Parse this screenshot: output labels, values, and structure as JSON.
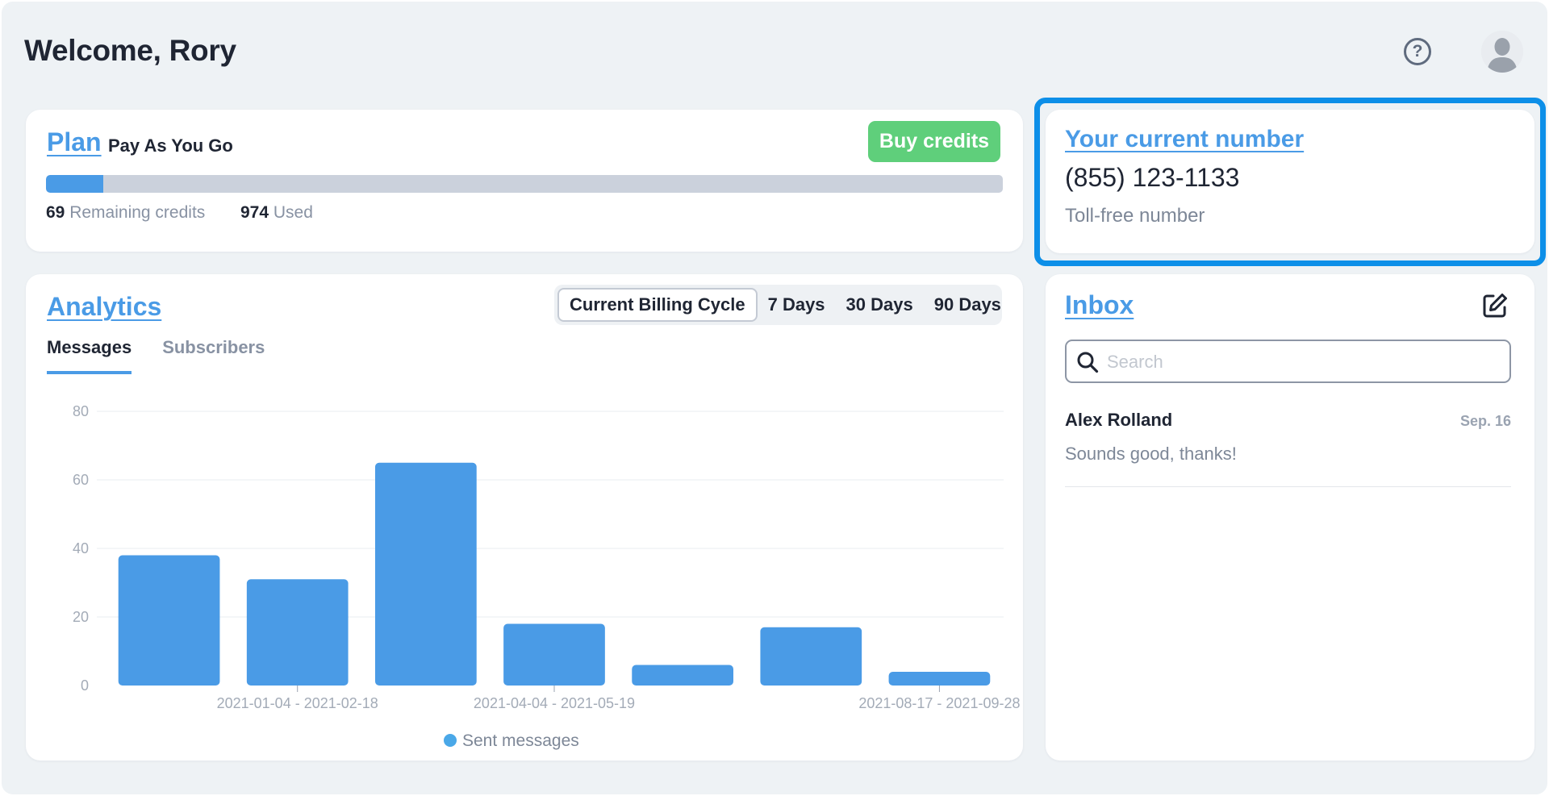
{
  "header": {
    "title": "Welcome, Rory",
    "help_glyph": "?",
    "icons": {
      "help": "help-circle-icon",
      "avatar": "user-avatar-icon"
    }
  },
  "plan": {
    "title": "Plan",
    "name": "Pay As You Go",
    "buy_label": "Buy credits",
    "remaining": "69",
    "remaining_label": "Remaining credits",
    "used": "974",
    "used_label": "Used",
    "usage_fraction": 0.06
  },
  "number": {
    "title": "Your current number",
    "value": "(855) 123-1133",
    "type": "Toll-free number"
  },
  "analytics": {
    "title": "Analytics",
    "ranges": [
      {
        "label": "Current Billing Cycle",
        "active": true
      },
      {
        "label": "7 Days",
        "active": false
      },
      {
        "label": "30 Days",
        "active": false
      },
      {
        "label": "90 Days",
        "active": false
      }
    ],
    "tabs": [
      {
        "label": "Messages",
        "active": true
      },
      {
        "label": "Subscribers",
        "active": false
      }
    ]
  },
  "chart_data": {
    "type": "bar",
    "categories": [
      "",
      "2021-01-04 - 2021-02-18",
      "",
      "2021-04-04 - 2021-05-19",
      "",
      "",
      "2021-08-17 - 2021-09-28"
    ],
    "series": [
      {
        "name": "Sent messages",
        "values": [
          38,
          31,
          65,
          18,
          6,
          17,
          4
        ]
      }
    ],
    "ylim": [
      0,
      80
    ],
    "yticks": [
      0,
      20,
      40,
      60,
      80
    ],
    "xtick_labels": [
      {
        "index": 1,
        "label": "2021-01-04 - 2021-02-18"
      },
      {
        "index": 3,
        "label": "2021-04-04 - 2021-05-19"
      },
      {
        "index": 6,
        "label": "2021-08-17 - 2021-09-28"
      }
    ],
    "grid": true,
    "legend": "bottom",
    "bar_color": "#4a9be6",
    "legend_color": "#4aa8e8",
    "title": "",
    "xlabel": "",
    "ylabel": ""
  },
  "inbox": {
    "title": "Inbox",
    "search_placeholder": "Search",
    "conversations": [
      {
        "name": "Alex Rolland",
        "date": "Sep. 16",
        "preview": "Sounds good, thanks!"
      }
    ]
  },
  "colors": {
    "accent": "#4a9be6",
    "success": "#5fcf7b",
    "highlight": "#0d8fe8",
    "background": "#eef2f5"
  }
}
